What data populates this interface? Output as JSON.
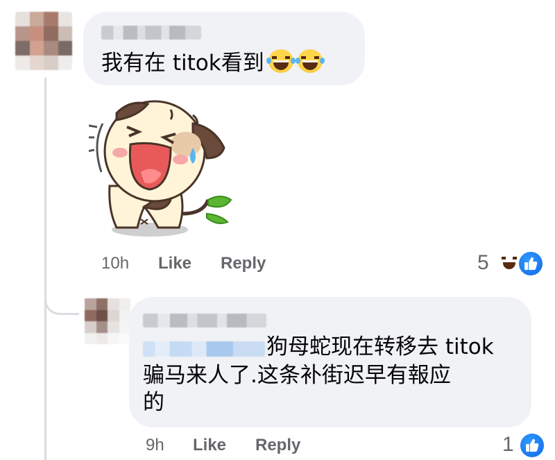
{
  "comments": [
    {
      "author_name": "",
      "text": "我有在 titok看到",
      "emoji": [
        "laugh-with-tears-emoji",
        "laugh-with-tears-emoji"
      ],
      "sticker": "laughing-cartoon-dog-sticker",
      "time": "10h",
      "like_label": "Like",
      "reply_label": "Reply",
      "reaction_count": "5",
      "reaction_icons": [
        "haha-icon",
        "like-icon"
      ]
    },
    {
      "author_name": "",
      "mention": "",
      "text_line1": "狗母蛇现在转移去 titok",
      "text_line2": "骗马来人了.这条补街迟早有報应",
      "text_line3": "的",
      "time": "9h",
      "like_label": "Like",
      "reply_label": "Reply",
      "reaction_count": "1",
      "reaction_icons": [
        "like-icon"
      ]
    }
  ],
  "colors": {
    "bubble": "#f0f2f5",
    "meta_text": "#65676b",
    "like_blue": "#1877f2",
    "thread_line": "#d9dce1"
  }
}
